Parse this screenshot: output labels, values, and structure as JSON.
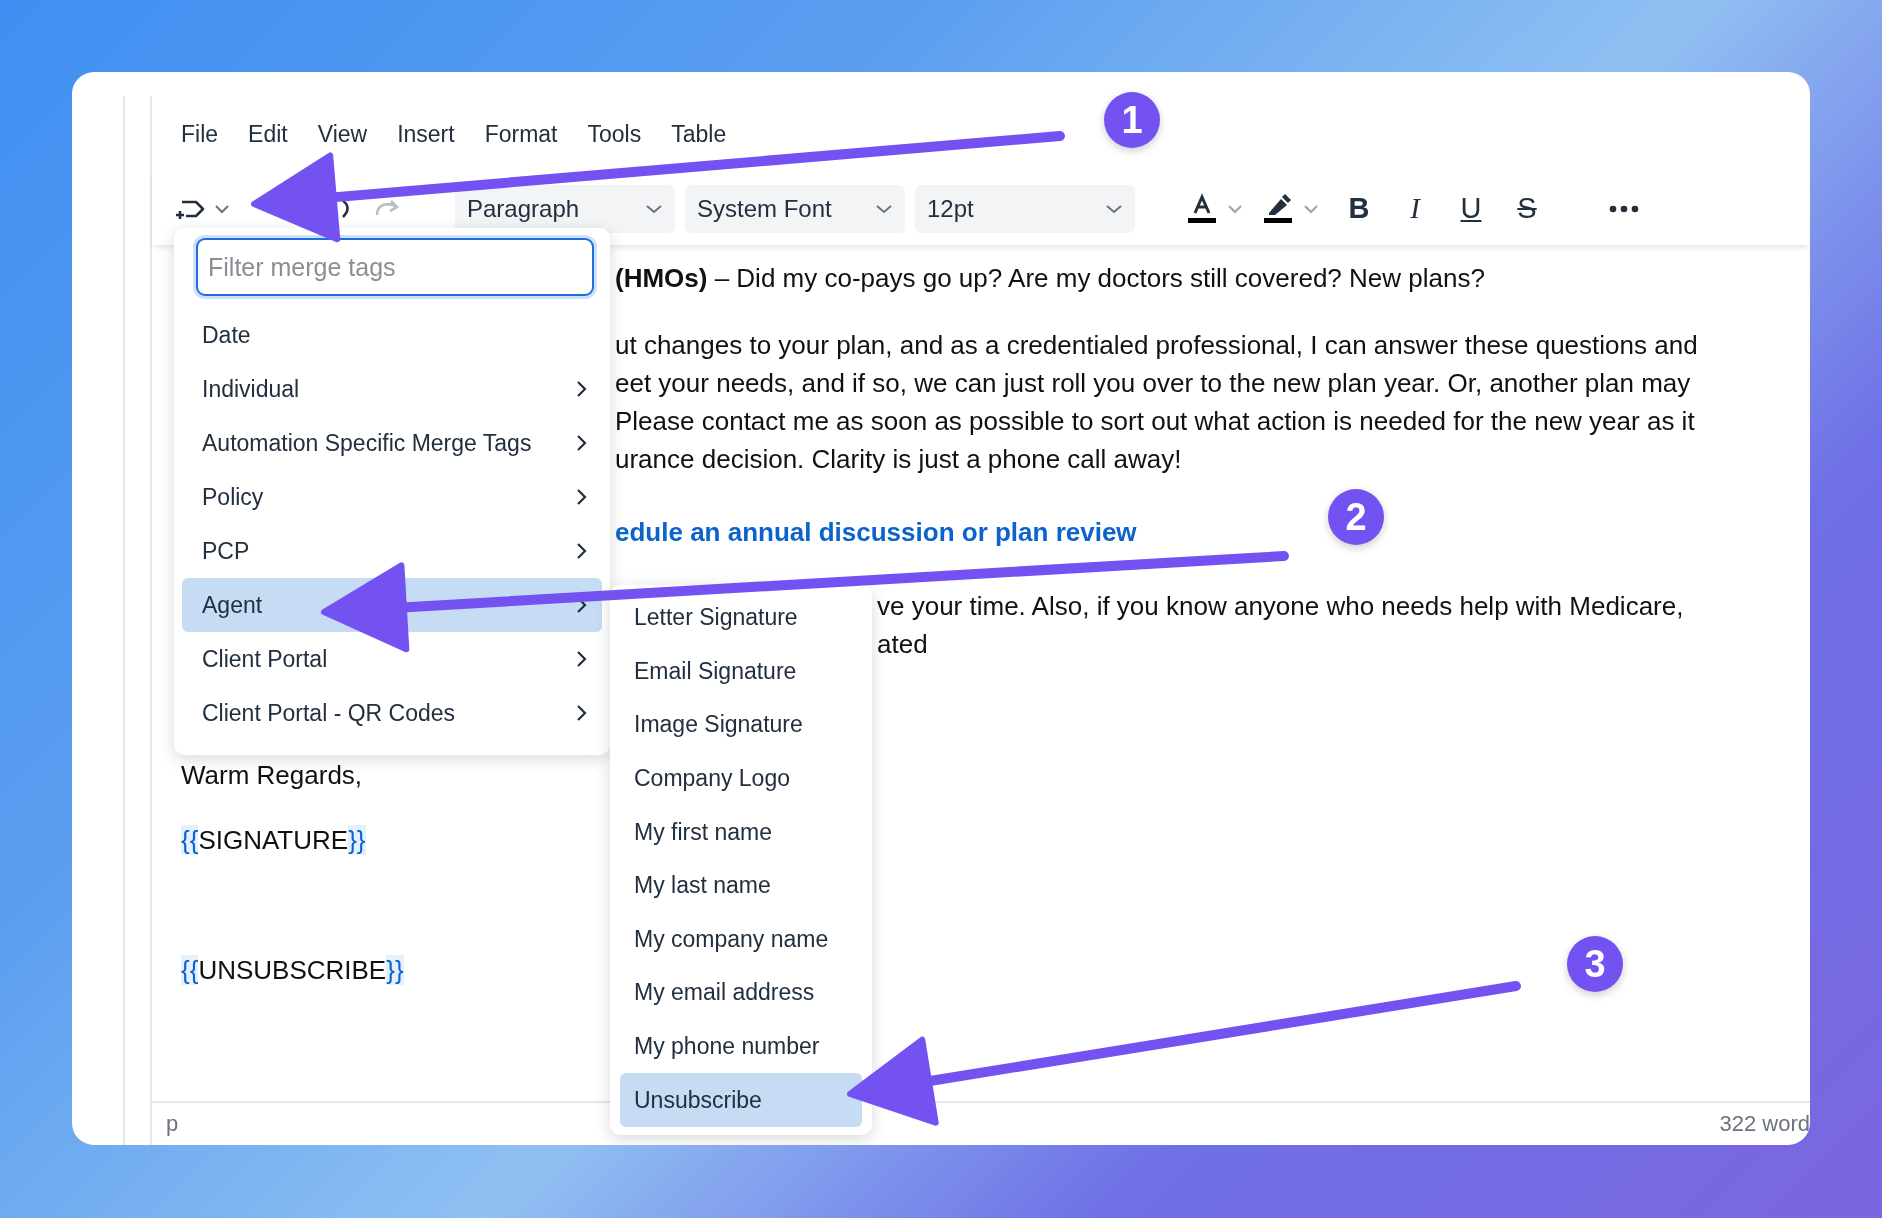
{
  "menubar": [
    "File",
    "Edit",
    "View",
    "Insert",
    "Format",
    "Tools",
    "Table"
  ],
  "toolbar": {
    "paragraph_style": "Paragraph",
    "font_family": "System Font",
    "font_size": "12pt",
    "format_buttons": [
      {
        "kind": "bold",
        "label": "B"
      },
      {
        "kind": "italic",
        "label": "I"
      },
      {
        "kind": "underline",
        "label": "U"
      },
      {
        "kind": "strike",
        "label": "S"
      }
    ]
  },
  "document": {
    "lines": [
      {
        "kind": "text",
        "text": "**(HMOs)** – Did my co-pays go up? Are my doctors still covered? New plans?"
      },
      {
        "kind": "para",
        "text": "ut changes to your plan, and as a credentialed professional, I can answer these questions and"
      },
      {
        "kind": "text",
        "text": "eet your needs, and if so, we can just roll you over to the new plan year. Or, another plan may"
      },
      {
        "kind": "text",
        "text": "Please contact me as soon as possible to sort out what action is needed for the new year as it"
      },
      {
        "kind": "text",
        "text": "urance decision. Clarity is just a phone call away!"
      },
      {
        "kind": "link",
        "text": "edule an annual discussion or plan review"
      },
      {
        "kind": "right",
        "text": "ve your time. Also, if you know anyone who needs help with Medicare,"
      },
      {
        "kind": "right2",
        "text": "ated"
      },
      {
        "kind": "closing",
        "text": "Warm Regards,"
      }
    ],
    "merge_tags": [
      {
        "open": "{{",
        "name": "SIGNATURE",
        "close": "}}"
      },
      {
        "open": "{{",
        "name": "UNSUBSCRIBE",
        "close": "}}"
      }
    ]
  },
  "merge_menu": {
    "filter_placeholder": "Filter merge tags",
    "items": [
      {
        "label": "Date",
        "has_submenu": false,
        "selected": false
      },
      {
        "label": "Individual",
        "has_submenu": true,
        "selected": false
      },
      {
        "label": "Automation Specific Merge Tags",
        "has_submenu": true,
        "selected": false
      },
      {
        "label": "Policy",
        "has_submenu": true,
        "selected": false
      },
      {
        "label": "PCP",
        "has_submenu": true,
        "selected": false
      },
      {
        "label": "Agent",
        "has_submenu": true,
        "selected": true
      },
      {
        "label": "Client Portal",
        "has_submenu": true,
        "selected": false
      },
      {
        "label": "Client Portal - QR Codes",
        "has_submenu": true,
        "selected": false
      }
    ]
  },
  "submenu": {
    "items": [
      {
        "label": "Letter Signature",
        "selected": false
      },
      {
        "label": "Email Signature",
        "selected": false
      },
      {
        "label": "Image Signature",
        "selected": false
      },
      {
        "label": "Company Logo",
        "selected": false
      },
      {
        "label": "My first name",
        "selected": false
      },
      {
        "label": "My last name",
        "selected": false
      },
      {
        "label": "My company name",
        "selected": false
      },
      {
        "label": "My email address",
        "selected": false
      },
      {
        "label": "My phone number",
        "selected": false
      },
      {
        "label": "Unsubscribe",
        "selected": true
      }
    ]
  },
  "status_bar": {
    "path": "p",
    "word_count": "322 word"
  },
  "annotations": [
    {
      "number": "1"
    },
    {
      "number": "2"
    },
    {
      "number": "3"
    }
  ]
}
